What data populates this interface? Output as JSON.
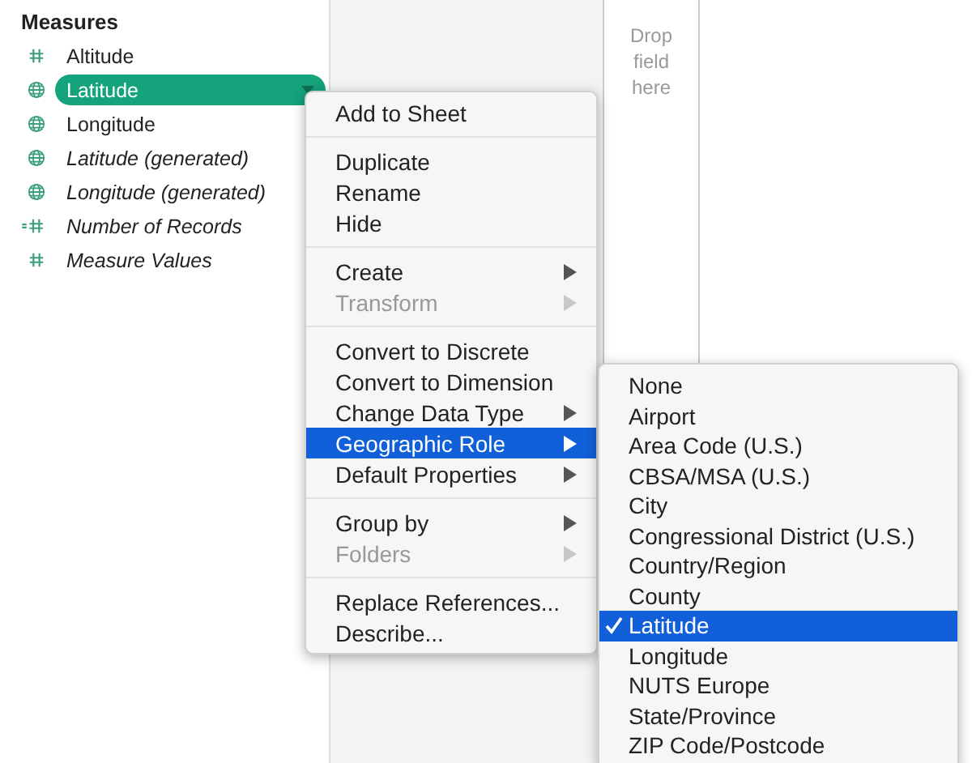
{
  "sidebar": {
    "heading": "Measures",
    "fields": [
      {
        "name": "Altitude",
        "kind": "number",
        "italic": false,
        "selected": false
      },
      {
        "name": "Latitude",
        "kind": "geo",
        "italic": false,
        "selected": true
      },
      {
        "name": "Longitude",
        "kind": "geo",
        "italic": false,
        "selected": false
      },
      {
        "name": "Latitude (generated)",
        "kind": "geo",
        "italic": true,
        "selected": false
      },
      {
        "name": "Longitude (generated)",
        "kind": "geo",
        "italic": true,
        "selected": false
      },
      {
        "name": "Number of Records",
        "kind": "count",
        "italic": true,
        "selected": false
      },
      {
        "name": "Measure Values",
        "kind": "number",
        "italic": true,
        "selected": false
      }
    ]
  },
  "shelf": {
    "placeholder": "Drop field here"
  },
  "context_menu": {
    "groups": [
      {
        "items": [
          {
            "label": "Add to Sheet",
            "submenu": false,
            "disabled": false,
            "selected": false
          }
        ]
      },
      {
        "items": [
          {
            "label": "Duplicate",
            "submenu": false,
            "disabled": false,
            "selected": false
          },
          {
            "label": "Rename",
            "submenu": false,
            "disabled": false,
            "selected": false
          },
          {
            "label": "Hide",
            "submenu": false,
            "disabled": false,
            "selected": false
          }
        ]
      },
      {
        "items": [
          {
            "label": "Create",
            "submenu": true,
            "disabled": false,
            "selected": false
          },
          {
            "label": "Transform",
            "submenu": true,
            "disabled": true,
            "selected": false
          }
        ]
      },
      {
        "items": [
          {
            "label": "Convert to Discrete",
            "submenu": false,
            "disabled": false,
            "selected": false
          },
          {
            "label": "Convert to Dimension",
            "submenu": false,
            "disabled": false,
            "selected": false
          },
          {
            "label": "Change Data Type",
            "submenu": true,
            "disabled": false,
            "selected": false
          },
          {
            "label": "Geographic Role",
            "submenu": true,
            "disabled": false,
            "selected": true
          },
          {
            "label": "Default Properties",
            "submenu": true,
            "disabled": false,
            "selected": false
          }
        ]
      },
      {
        "items": [
          {
            "label": "Group by",
            "submenu": true,
            "disabled": false,
            "selected": false
          },
          {
            "label": "Folders",
            "submenu": true,
            "disabled": true,
            "selected": false
          }
        ]
      },
      {
        "items": [
          {
            "label": "Replace References...",
            "submenu": false,
            "disabled": false,
            "selected": false
          },
          {
            "label": "Describe...",
            "submenu": false,
            "disabled": false,
            "selected": false
          }
        ]
      }
    ]
  },
  "submenu": {
    "items": [
      {
        "label": "None",
        "checked": false,
        "selected": false
      },
      {
        "label": "Airport",
        "checked": false,
        "selected": false
      },
      {
        "label": "Area Code (U.S.)",
        "checked": false,
        "selected": false
      },
      {
        "label": "CBSA/MSA (U.S.)",
        "checked": false,
        "selected": false
      },
      {
        "label": "City",
        "checked": false,
        "selected": false
      },
      {
        "label": "Congressional District (U.S.)",
        "checked": false,
        "selected": false
      },
      {
        "label": "Country/Region",
        "checked": false,
        "selected": false
      },
      {
        "label": "County",
        "checked": false,
        "selected": false
      },
      {
        "label": "Latitude",
        "checked": true,
        "selected": true
      },
      {
        "label": "Longitude",
        "checked": false,
        "selected": false
      },
      {
        "label": "NUTS Europe",
        "checked": false,
        "selected": false
      },
      {
        "label": "State/Province",
        "checked": false,
        "selected": false
      },
      {
        "label": "ZIP Code/Postcode",
        "checked": false,
        "selected": false
      }
    ]
  }
}
